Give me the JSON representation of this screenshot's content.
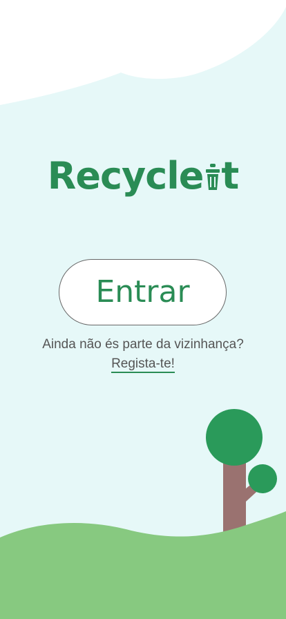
{
  "app": {
    "logo_text_before": "Recycle",
    "logo_text_after": "t"
  },
  "login": {
    "button_label": "Entrar"
  },
  "register": {
    "prompt": "Ainda não és parte da vizinhança?",
    "link_label": "Regista-te!"
  },
  "colors": {
    "background": "#e6f8f8",
    "brand_green": "#2a8c55",
    "grass": "#87c980",
    "tree_trunk": "#9a7270",
    "cloud": "#ffffff"
  }
}
